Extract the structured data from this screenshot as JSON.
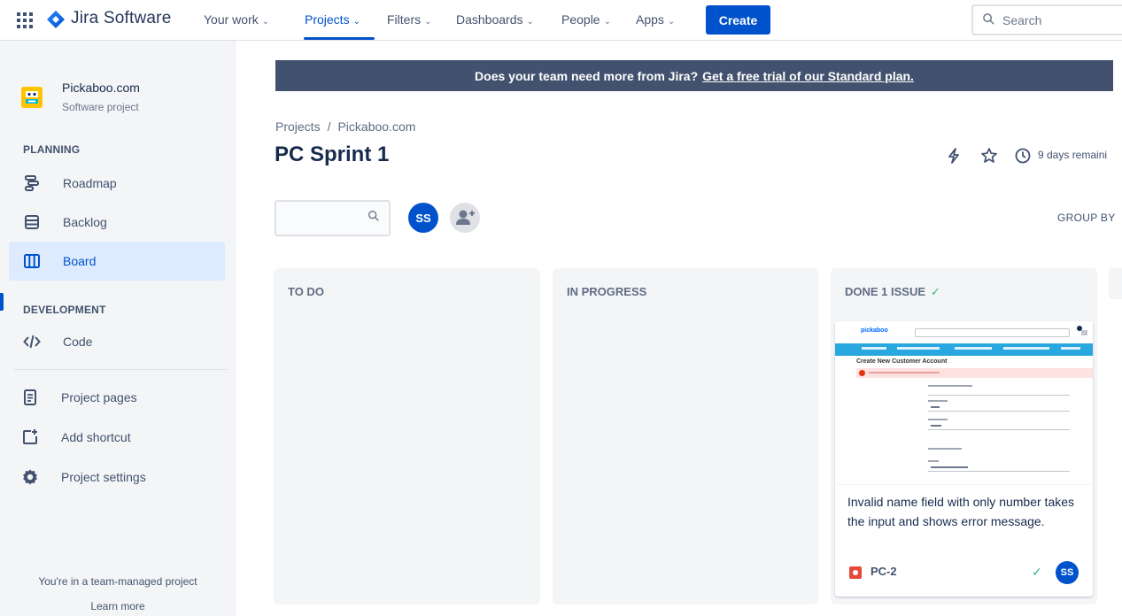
{
  "nav": {
    "brand": "Jira Software",
    "items": [
      {
        "label": "Your work"
      },
      {
        "label": "Projects"
      },
      {
        "label": "Filters"
      },
      {
        "label": "Dashboards"
      },
      {
        "label": "People"
      },
      {
        "label": "Apps"
      }
    ],
    "create_label": "Create",
    "search_placeholder": "Search"
  },
  "sidebar": {
    "project_name": "Pickaboo.com",
    "project_type": "Software project",
    "planning_heading": "PLANNING",
    "planning_items": [
      {
        "label": "Roadmap",
        "icon": "roadmap-icon"
      },
      {
        "label": "Backlog",
        "icon": "backlog-icon"
      },
      {
        "label": "Board",
        "icon": "board-icon",
        "active": true
      }
    ],
    "development_heading": "DEVELOPMENT",
    "development_items": [
      {
        "label": "Code",
        "icon": "code-icon"
      }
    ],
    "other_items": [
      {
        "label": "Project pages",
        "icon": "page-icon"
      },
      {
        "label": "Add shortcut",
        "icon": "add-shortcut-icon"
      },
      {
        "label": "Project settings",
        "icon": "gear-icon"
      }
    ],
    "footer_text": "You're in a team-managed project",
    "footer_link": "Learn more"
  },
  "banner": {
    "text": "Does your team need more from Jira?",
    "link": "Get a free trial of our Standard plan."
  },
  "breadcrumb": {
    "root": "Projects",
    "separator": "/",
    "project": "Pickaboo.com"
  },
  "sprint": {
    "title": "PC Sprint 1",
    "days_remaining": "9 days remaini"
  },
  "board": {
    "assignee_initials": "SS",
    "group_by_label": "GROUP BY",
    "columns": [
      {
        "title": "TO DO"
      },
      {
        "title": "IN PROGRESS"
      },
      {
        "title": "DONE 1 ISSUE"
      }
    ],
    "card": {
      "thumb_logo": "pickaboo",
      "thumb_title": "Create New Customer Account",
      "summary": "Invalid name field with only number takes the input and shows error message.",
      "key": "PC-2",
      "assignee": "SS"
    }
  },
  "colors": {
    "primary": "#0052CC",
    "banner_bg": "#42526E",
    "sidebar_bg": "#F4F5F7",
    "done_green": "#36B37E",
    "bug_red": "#E5493A"
  }
}
